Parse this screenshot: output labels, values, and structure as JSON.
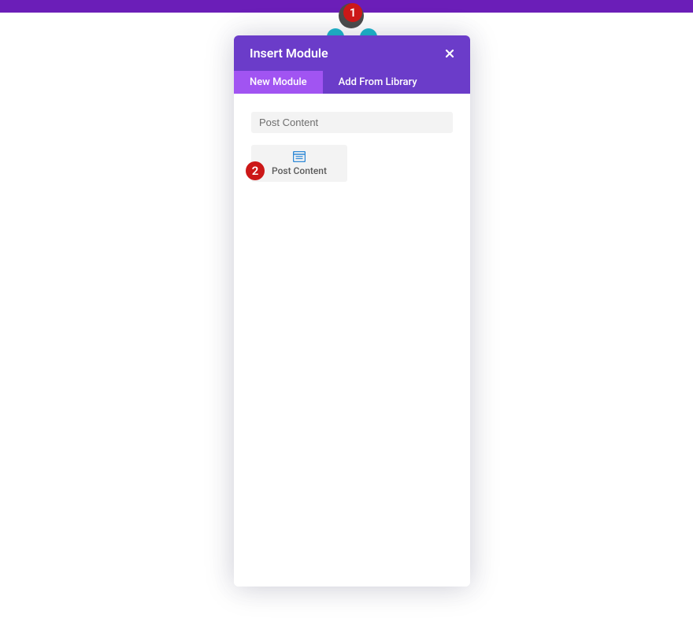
{
  "topbar": {
    "add_icon": "plus-icon"
  },
  "annotations": {
    "badge_1": "1",
    "badge_2": "2"
  },
  "modal": {
    "title": "Insert Module",
    "tabs": {
      "new_module": "New Module",
      "add_from_library": "Add From Library"
    },
    "search": {
      "value": "Post Content"
    },
    "modules": [
      {
        "name": "Post Content"
      }
    ]
  }
}
